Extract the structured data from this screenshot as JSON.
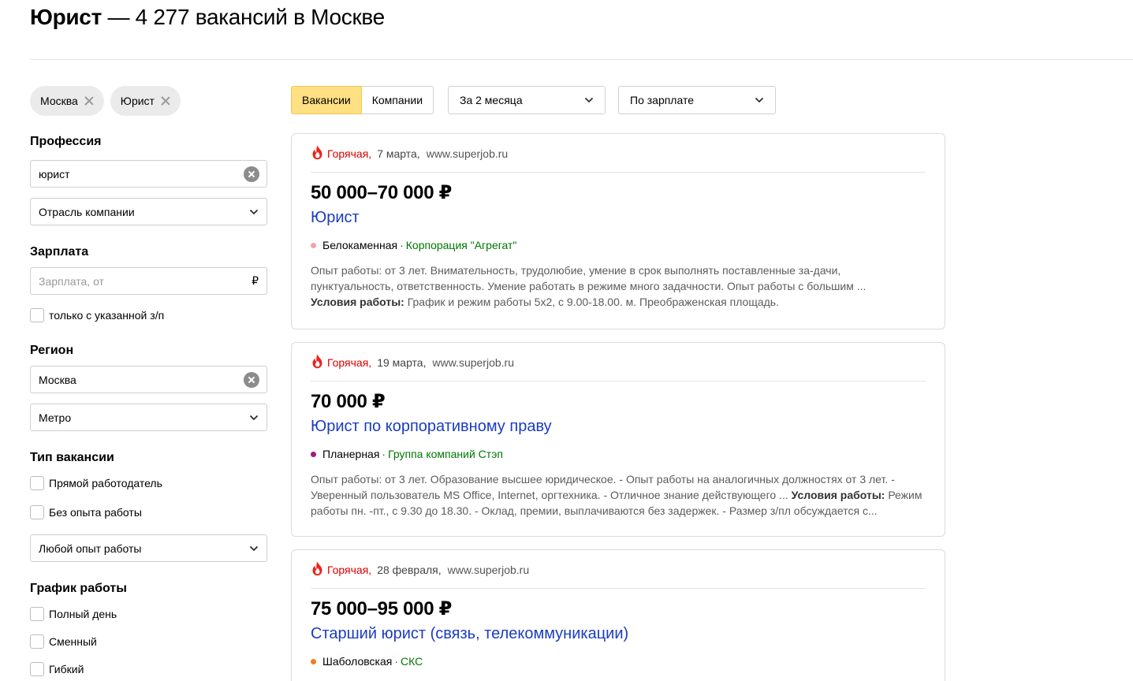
{
  "header": {
    "title_bold": "Юрист",
    "title_rest": " — 4 277 вакансий в Москве"
  },
  "chips": [
    {
      "label": "Москва"
    },
    {
      "label": "Юрист"
    }
  ],
  "filters": {
    "profession_title": "Профессия",
    "profession_value": "юрист",
    "industry_select": "Отрасль компании",
    "salary_title": "Зарплата",
    "salary_placeholder": "Зарплата, от",
    "salary_currency": "₽",
    "salary_only_label": "только с указанной з/п",
    "region_title": "Регион",
    "region_value": "Москва",
    "metro_select": "Метро",
    "vacancy_type_title": "Тип вакансии",
    "direct_employer_label": "Прямой работодатель",
    "no_experience_label": "Без опыта работы",
    "experience_select": "Любой опыт работы",
    "schedule_title": "График работы",
    "full_day_label": "Полный день",
    "shift_label": "Сменный",
    "flexible_label": "Гибкий"
  },
  "toolbar": {
    "tab_vacancies": "Вакансии",
    "tab_companies": "Компании",
    "period_select": "За 2 месяца",
    "sort_select": "По зарплате"
  },
  "results": [
    {
      "hot": "Горячая,",
      "date": "7 марта,",
      "source": "www.superjob.ru",
      "salary": "50 000–70 000 ₽",
      "title": "Юрист",
      "metro": "Белокаменная",
      "metro_color": "#f4a1a9",
      "company": "Корпорация \"Агрегат\"",
      "desc": "Опыт работы: от 3 лет. Внимательность, трудолюбие, умение в срок выполнять поставленные за-дачи, пунктуальность, ответственность. Умение работать в режиме много задачности. Опыт работы с большим ...",
      "cond_label": "Условия работы:",
      "cond_text": " График и режим работы 5х2, с 9.00-18.00. м. Преображенская площадь."
    },
    {
      "hot": "Горячая,",
      "date": "19 марта,",
      "source": "www.superjob.ru",
      "salary": "70 000 ₽",
      "title": "Юрист по корпоративному праву",
      "metro": "Планерная",
      "metro_color": "#a0197b",
      "company": "Группа компаний Стэп",
      "desc": "Опыт работы: от 3 лет. Образование высшее юридическое. - Опыт работы на аналогичных должностях от 3 лет. - Уверенный пользователь MS Office, Internet, оргтехника. - Отличное знание действующего ... ",
      "cond_label": "Условия работы:",
      "cond_text": " Режим работы пн. -пт., с 9.30 до 18.30. - Оклад, премии, выплачиваются без задержек. - Размер з/пл обсуждается с..."
    },
    {
      "hot": "Горячая,",
      "date": "28 февраля,",
      "source": "www.superjob.ru",
      "salary": "75 000–95 000 ₽",
      "title": "Старший юрист (связь, телекоммуникации)",
      "metro": "Шаболовская",
      "metro_color": "#f07e1f",
      "company": "СКС",
      "desc": "",
      "cond_label": "",
      "cond_text": ""
    }
  ]
}
